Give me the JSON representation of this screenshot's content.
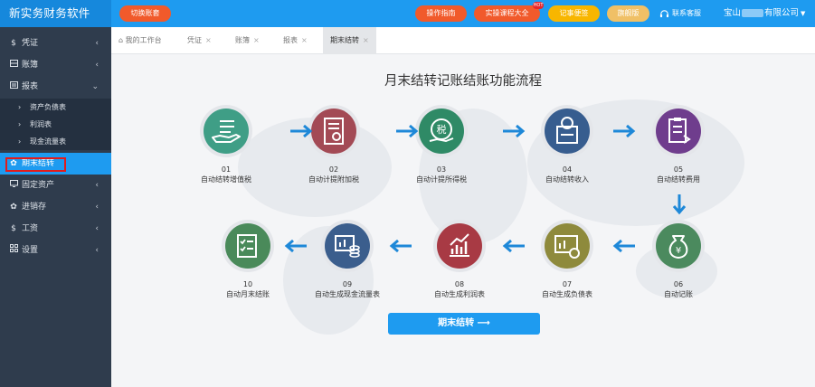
{
  "header": {
    "app_title": "新实务财务软件",
    "switch_label": "切换账套",
    "guide_label": "操作指南",
    "course_label": "实操课程大全",
    "hot_badge": "HOT",
    "memo_label": "记事便签",
    "flagship_label": "旗舰版",
    "service_label": "联系客服",
    "company_prefix": "宝山",
    "company_suffix": "有限公司"
  },
  "sidebar": {
    "items": [
      {
        "label": "凭证",
        "icon": "dollar-icon"
      },
      {
        "label": "账簿",
        "icon": "book-icon"
      },
      {
        "label": "报表",
        "icon": "report-icon"
      },
      {
        "label": "期末结转",
        "icon": "gear-icon"
      },
      {
        "label": "固定资产",
        "icon": "monitor-icon"
      },
      {
        "label": "进销存",
        "icon": "gear-icon"
      },
      {
        "label": "工资",
        "icon": "dollar-icon"
      },
      {
        "label": "设置",
        "icon": "grid-icon"
      }
    ],
    "report_subitems": [
      "资产负债表",
      "利润表",
      "现金流量表"
    ]
  },
  "tabs": {
    "home": "我的工作台",
    "items": [
      "凭证",
      "账簿",
      "报表",
      "期末结转"
    ]
  },
  "main": {
    "title": "月末结转记账结账功能流程",
    "button_label": "期末结转 ⟶",
    "steps": [
      {
        "num": "01",
        "label": "自动结转增值税",
        "color": "#3f9e86",
        "icon": "hand-list-icon"
      },
      {
        "num": "02",
        "label": "自动计提附加税",
        "color": "#a34a55",
        "icon": "certificate-icon"
      },
      {
        "num": "03",
        "label": "自动计提所得税",
        "color": "#2f8a66",
        "icon": "tax-bag-icon"
      },
      {
        "num": "04",
        "label": "自动结转收入",
        "color": "#375d8f",
        "icon": "income-folder-icon"
      },
      {
        "num": "05",
        "label": "自动结转费用",
        "color": "#6f3d8d",
        "icon": "expense-clipboard-icon"
      },
      {
        "num": "06",
        "label": "自动记账",
        "color": "#4b8a5e",
        "icon": "money-bag-icon"
      },
      {
        "num": "07",
        "label": "自动生成负债表",
        "color": "#8e8a3c",
        "icon": "balance-sheet-icon"
      },
      {
        "num": "08",
        "label": "自动生成利润表",
        "color": "#a83a44",
        "icon": "profit-chart-icon"
      },
      {
        "num": "09",
        "label": "自动生成现金流量表",
        "color": "#3b5e8d",
        "icon": "cashflow-icon"
      },
      {
        "num": "10",
        "label": "自动月末结账",
        "color": "#4a8a5a",
        "icon": "checklist-icon"
      }
    ]
  },
  "colors": {
    "header_blue": "#1e9bf0",
    "sidebar_bg": "#2f3c4d",
    "accent_orange": "#f15a2b",
    "memo_yellow": "#f8b600",
    "flow_arrow": "#1e88d8",
    "highlight_red": "#e21b1b"
  }
}
